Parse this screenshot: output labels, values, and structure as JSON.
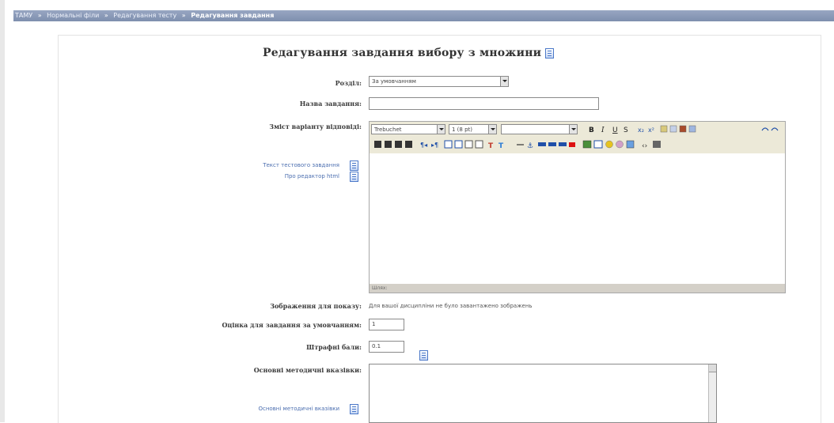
{
  "breadcrumb": {
    "items": [
      "ТАМУ",
      "Нормальні філи",
      "Редагування тесту",
      "Редагування завдання"
    ],
    "separator": "»"
  },
  "page": {
    "title": "Редагування завдання вибору з множини"
  },
  "form": {
    "category_label": "Розділ:",
    "category_value": "За умовчанням",
    "name_label": "Назва завдання:",
    "name_value": "",
    "answer_label": "Зміст варіанту відповіді:",
    "help_link_1": "Текст тестового завдання",
    "help_link_2": "Про редактор html",
    "image_label": "Зображення для показу:",
    "image_text": "Для вашої дисципліни не було завантажено зображень",
    "grade_label": "Оцінка для завдання за умовчанням:",
    "grade_value": "1",
    "penalty_label": "Штрафні бали:",
    "penalty_value": "0.1",
    "notes_label": "Основні методичні вказівки:",
    "notes_help_link": "Основні методичні вказівки"
  },
  "editor": {
    "font_value": "Trebuchet",
    "size_value": "1 (8 pt)",
    "style_value": "",
    "status_text": "Шлях:"
  },
  "colors": {
    "breadcrumb_bg": "#8796b4",
    "link": "#4c6fb0",
    "toolbar_bg": "#ece9d8"
  }
}
